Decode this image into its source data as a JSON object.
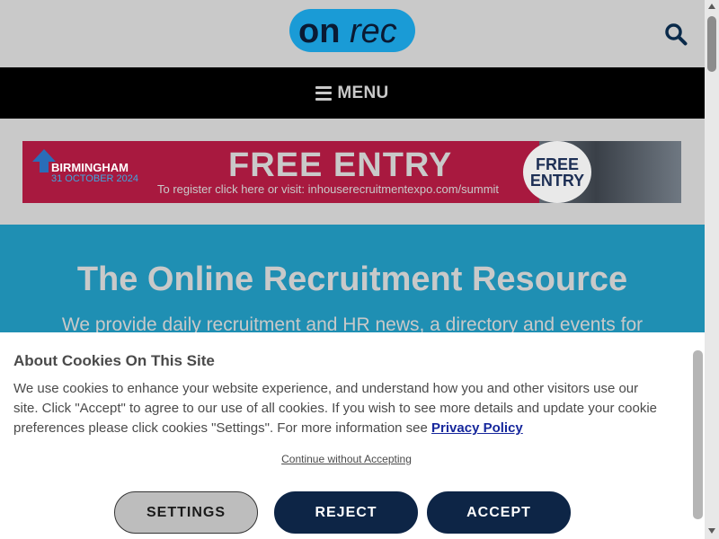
{
  "header": {
    "logo_text_left": "on",
    "logo_text_right": "rec",
    "search_icon": "search-icon",
    "colors": {
      "logo_bg": "#1a9bd6",
      "logo_dark": "#0a1a33"
    }
  },
  "menu": {
    "label": "MENU",
    "icon": "hamburger-icon"
  },
  "banner": {
    "event_line1": "BIRMINGHAM",
    "event_line2": "31 OCTOBER 2024",
    "headline": "FREE ENTRY",
    "register_text": "To register click here or visit: inhouserecruitmentexpo.com/summit",
    "badge_line1": "FREE",
    "badge_line2": "ENTRY"
  },
  "hero": {
    "title": "The Online Recruitment Resource",
    "description": "We provide daily recruitment and HR news, a directory and events for"
  },
  "cookie": {
    "title": "About Cookies On This Site",
    "text": "We use cookies to enhance your website experience, and understand how you and other visitors use our site. Click \"Accept\" to agree to our use of all cookies. If you wish to see more details and update your cookie preferences please click cookies \"Settings\". For more information see ",
    "privacy_link": "Privacy Policy",
    "continue_link": "Continue without Accepting",
    "buttons": {
      "settings": "SETTINGS",
      "reject": "REJECT",
      "accept": "ACCEPT"
    },
    "colors": {
      "primary_button": "#0d2546",
      "link": "#16279c"
    }
  }
}
